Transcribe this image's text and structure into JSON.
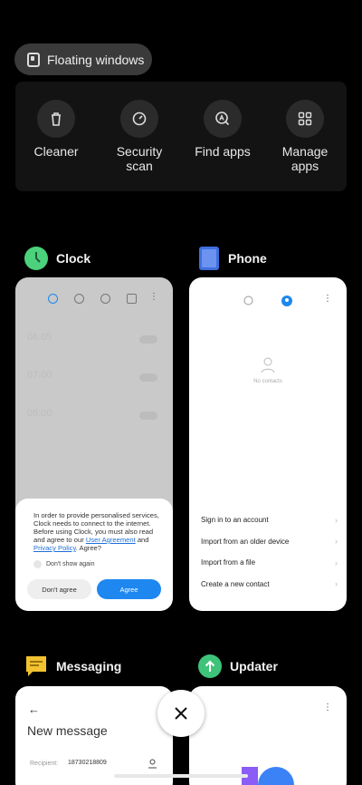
{
  "floating_windows": {
    "label": "Floating windows"
  },
  "quick_actions": [
    {
      "label": "Cleaner",
      "icon": "trash-icon"
    },
    {
      "label": "Security\nscan",
      "icon": "security-scan-icon"
    },
    {
      "label": "Find apps",
      "icon": "find-apps-icon"
    },
    {
      "label": "Manage\napps",
      "icon": "grid-icon"
    }
  ],
  "apps": {
    "clock": {
      "name": "Clock",
      "alarm_times": [
        "06:05",
        "07:00",
        "08:00"
      ],
      "dialog": {
        "text_before": "In order to provide personalised services, Clock needs to connect to the internet. Before using Clock, you must also read and agree to our ",
        "link1": "User Agreement",
        "text_and": " and ",
        "link2": "Privacy Policy",
        "text_after": ". Agree?",
        "checkbox": "Don't show again",
        "disagree": "Don't agree",
        "agree": "Agree"
      }
    },
    "phone": {
      "name": "Phone",
      "empty_text": "No contacts",
      "actions": [
        "Sign in to an account",
        "Import from an older device",
        "Import from a file",
        "Create a new contact"
      ]
    },
    "messaging": {
      "name": "Messaging",
      "title": "New message",
      "recipient_label": "Recipient:",
      "recipient_value": "18730218809"
    },
    "updater": {
      "name": "Updater"
    }
  },
  "colors": {
    "accent": "#1e87f0",
    "clock_icon": "#4cd17c",
    "phone_icon": "#3f6fde",
    "messaging_icon": "#f2c230",
    "updater_icon": "#3ec47a"
  }
}
